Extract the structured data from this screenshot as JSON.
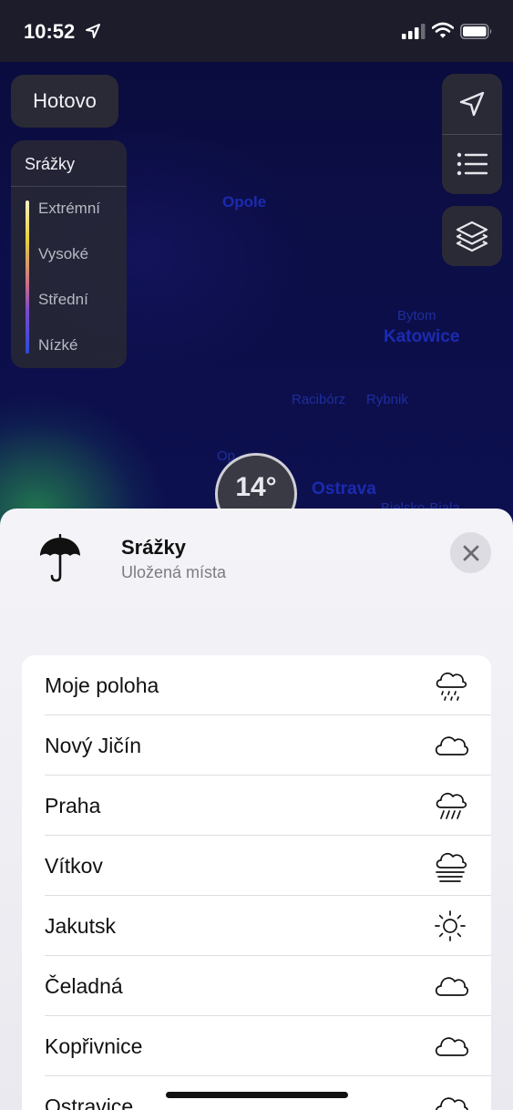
{
  "status_bar": {
    "time": "10:52"
  },
  "map": {
    "labels": [
      "Opole",
      "Bytom",
      "Katowice",
      "Racibórz",
      "Rybnik",
      "Op...",
      "Ostrava",
      "Bielsko-Biala"
    ],
    "done_button": "Hotovo",
    "legend": {
      "title": "Srážky",
      "items": [
        "Extrémní",
        "Vysoké",
        "Střední",
        "Nízké"
      ]
    },
    "temperature": "14°"
  },
  "sheet": {
    "title": "Srážky",
    "subtitle": "Uložená místa",
    "locations": [
      {
        "name": "Moje poloha",
        "icon": "cloud-drizzle-icon"
      },
      {
        "name": "Nový Jičín",
        "icon": "cloud-icon"
      },
      {
        "name": "Praha",
        "icon": "cloud-rain-icon"
      },
      {
        "name": "Vítkov",
        "icon": "cloud-fog-icon"
      },
      {
        "name": "Jakutsk",
        "icon": "sun-icon"
      },
      {
        "name": "Čeladná",
        "icon": "cloud-icon"
      },
      {
        "name": "Kopřivnice",
        "icon": "cloud-icon"
      },
      {
        "name": "Ostravice",
        "icon": "cloud-icon"
      }
    ]
  }
}
